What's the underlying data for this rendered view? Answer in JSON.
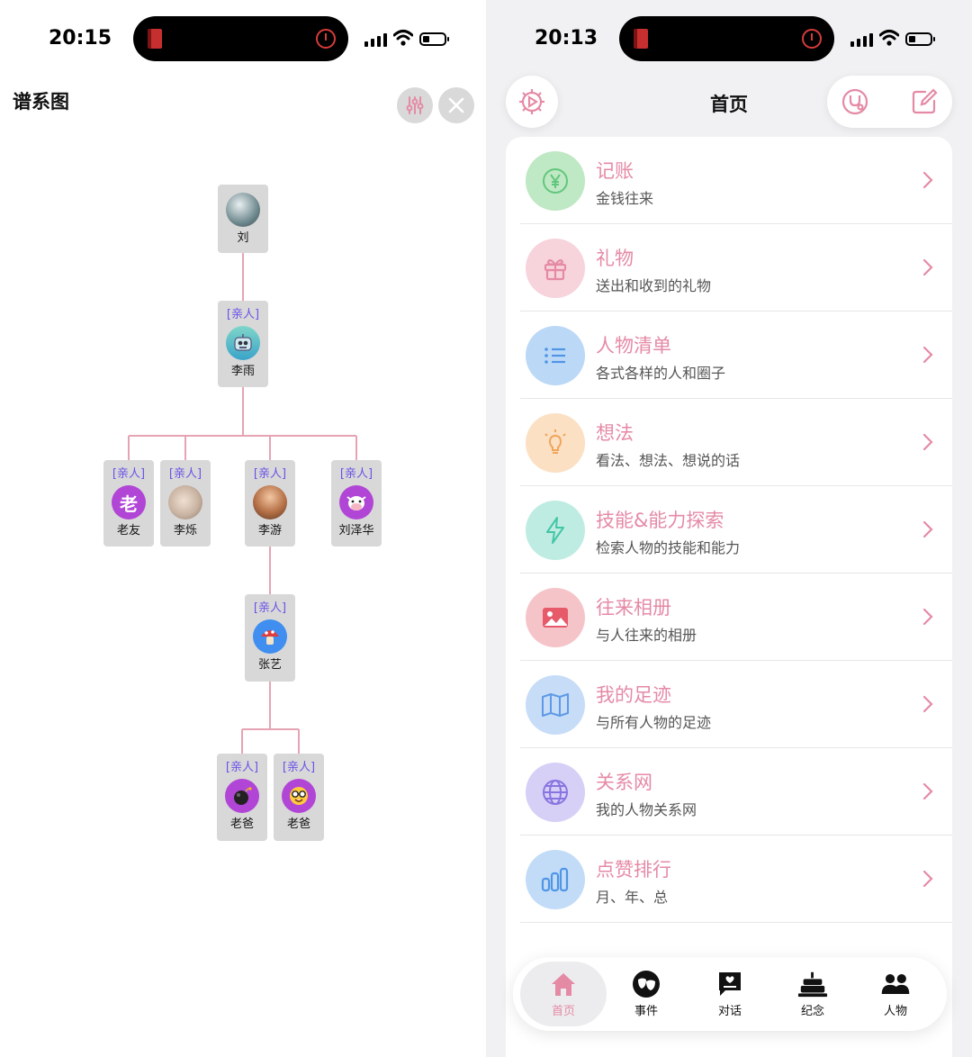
{
  "left_screen": {
    "status": {
      "time": "20:15"
    },
    "title": "谱系图",
    "tree": {
      "root": {
        "name": "刘",
        "avatar": "photo"
      },
      "level1": {
        "tag": "[亲人]",
        "name": "李雨",
        "avatar": "robot-emoji"
      },
      "level2": [
        {
          "tag": "[亲人]",
          "name": "老友",
          "avatar_text": "老"
        },
        {
          "tag": "[亲人]",
          "name": "李烁",
          "avatar": "photo"
        },
        {
          "tag": "[亲人]",
          "name": "李游",
          "avatar": "photo"
        },
        {
          "tag": "[亲人]",
          "name": "刘泽华",
          "avatar": "cow-emoji"
        }
      ],
      "level3": {
        "tag": "[亲人]",
        "name": "张艺",
        "avatar": "mushroom-emoji"
      },
      "level4": [
        {
          "tag": "[亲人]",
          "name": "老爸",
          "avatar": "bomb-emoji"
        },
        {
          "tag": "[亲人]",
          "name": "老爸",
          "avatar": "nerd-face-emoji"
        }
      ]
    },
    "buttons": [
      "filter-sliders-icon",
      "close-icon"
    ]
  },
  "right_screen": {
    "status": {
      "time": "20:13"
    },
    "nav": {
      "title": "首页",
      "left": "settings-gear-icon",
      "right": [
        "stethoscope-icon",
        "edit-icon"
      ]
    },
    "menu": [
      {
        "title": "记账",
        "subtitle": "金钱往来",
        "icon": "yen-coin-icon",
        "color": "#bfe8c4",
        "stroke": "#62c77c"
      },
      {
        "title": "礼物",
        "subtitle": "送出和收到的礼物",
        "icon": "gift-icon",
        "color": "#f7d3dc",
        "stroke": "#e58aa5"
      },
      {
        "title": "人物清单",
        "subtitle": "各式各样的人和圈子",
        "icon": "list-icon",
        "color": "#bcd8f7",
        "stroke": "#4f95e6"
      },
      {
        "title": "想法",
        "subtitle": "看法、想法、想说的话",
        "icon": "lightbulb-icon",
        "color": "#fbe0c4",
        "stroke": "#f0a55a"
      },
      {
        "title": "技能&能力探索",
        "subtitle": "检索人物的技能和能力",
        "icon": "lightning-icon",
        "color": "#bfece2",
        "stroke": "#43c6a6"
      },
      {
        "title": "往来相册",
        "subtitle": "与人往来的相册",
        "icon": "photo-icon",
        "color": "#f5c4c8",
        "stroke": "#e65a6a"
      },
      {
        "title": "我的足迹",
        "subtitle": "与所有人物的足迹",
        "icon": "map-icon",
        "color": "#c6dcf7",
        "stroke": "#5e9ae6"
      },
      {
        "title": "关系网",
        "subtitle": "我的人物关系网",
        "icon": "globe-icon",
        "color": "#d6d0f7",
        "stroke": "#8874e0"
      },
      {
        "title": "点赞排行",
        "subtitle": "月、年、总",
        "icon": "bar-chart-icon",
        "color": "#c2dcf7",
        "stroke": "#4f95e6"
      }
    ],
    "tabs": [
      {
        "label": "首页",
        "icon": "home-icon",
        "active": true
      },
      {
        "label": "事件",
        "icon": "theater-masks-icon",
        "active": false
      },
      {
        "label": "对话",
        "icon": "message-heart-icon",
        "active": false
      },
      {
        "label": "纪念",
        "icon": "cake-icon",
        "active": false
      },
      {
        "label": "人物",
        "icon": "people-icon",
        "active": false
      }
    ]
  }
}
